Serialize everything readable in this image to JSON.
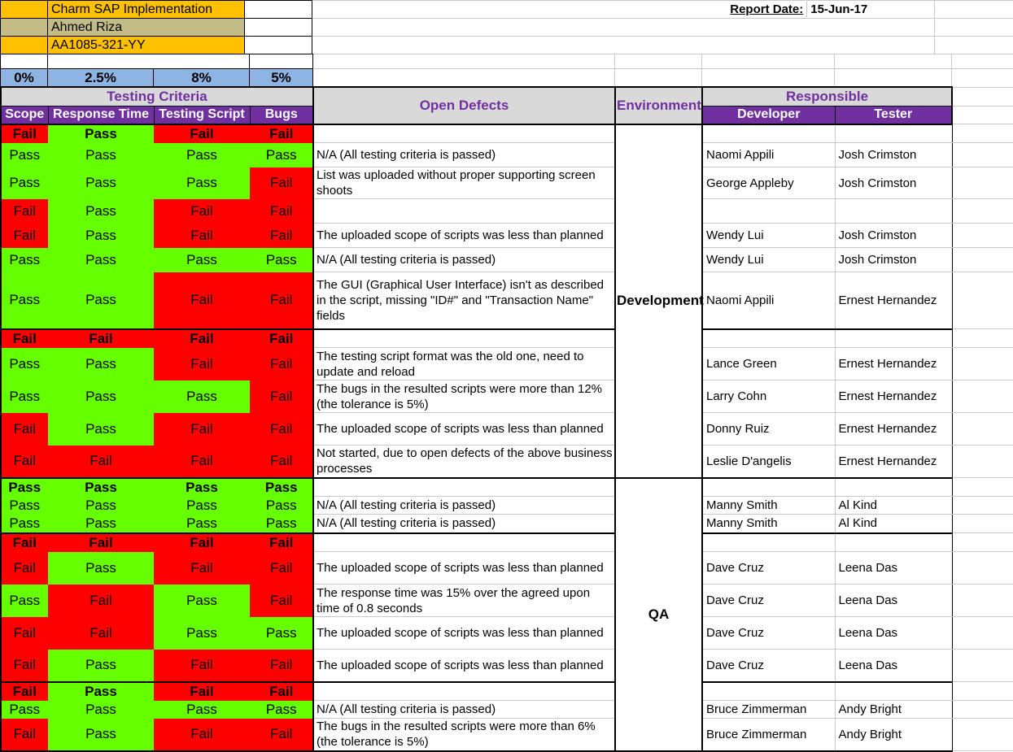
{
  "project": {
    "name": "Charm SAP Implementation",
    "manager": "Ahmed Riza",
    "code": "AA1085-321-YY"
  },
  "report": {
    "date_label": "Report Date:",
    "date_value": "15-Jun-17"
  },
  "tolerances": {
    "scope": "0%",
    "response_time": "2.5%",
    "testing_script": "8%",
    "bugs": "5%"
  },
  "headers": {
    "testing_criteria": "Testing Criteria",
    "scope": "Scope",
    "response_time": "Response Time",
    "testing_script": "Testing Script",
    "bugs": "Bugs",
    "open_defects": "Open Defects",
    "environment": "Environment",
    "responsible": "Responsible",
    "developer": "Developer",
    "tester": "Tester"
  },
  "environments": {
    "development": "Development",
    "qa": "QA"
  },
  "status_values": {
    "pass": "Pass",
    "fail": "Fail"
  },
  "colors": {
    "pass": "#66FF00",
    "fail": "#FF0000",
    "header_purple": "#7030A0",
    "header_grey": "#D9D9D9",
    "tolerance_blue": "#8EB4E3",
    "title_gold": "#FFC000",
    "title_tan": "#C4BC86"
  },
  "rows": [
    {
      "scope": "Fail",
      "response": "Pass",
      "script": "Fail",
      "bugs": "Fail",
      "summary": true,
      "defect": "",
      "developer": "",
      "tester": ""
    },
    {
      "scope": "Pass",
      "response": "Pass",
      "script": "Pass",
      "bugs": "Pass",
      "summary": false,
      "defect": "N/A (All testing criteria is passed)",
      "developer": "Naomi Appili",
      "tester": "Josh Crimston"
    },
    {
      "scope": "Pass",
      "response": "Pass",
      "script": "Pass",
      "bugs": "Fail",
      "summary": false,
      "defect": "List was uploaded without proper supporting screen shoots",
      "developer": "George Appleby",
      "tester": "Josh Crimston"
    },
    {
      "scope": "Fail",
      "response": "Pass",
      "script": "Fail",
      "bugs": "Fail",
      "summary": false,
      "defect": "",
      "developer": "",
      "tester": ""
    },
    {
      "scope": "Fail",
      "response": "Pass",
      "script": "Fail",
      "bugs": "Fail",
      "summary": false,
      "defect": "The uploaded scope of scripts was less than planned",
      "developer": "Wendy Lui",
      "tester": "Josh Crimston"
    },
    {
      "scope": "Pass",
      "response": "Pass",
      "script": "Pass",
      "bugs": "Pass",
      "summary": false,
      "defect": "N/A (All testing criteria is passed)",
      "developer": "Wendy Lui",
      "tester": "Josh Crimston"
    },
    {
      "scope": "Pass",
      "response": "Pass",
      "script": "Fail",
      "bugs": "Fail",
      "summary": false,
      "defect": "The GUI (Graphical User Interface) isn't as described in the script, missing \"ID#\" and \"Transaction Name\" fields",
      "developer": "Naomi Appili",
      "tester": "Ernest Hernandez"
    },
    {
      "scope": "Fail",
      "response": "Fail",
      "script": "Fail",
      "bugs": "Fail",
      "summary": true,
      "defect": "",
      "developer": "",
      "tester": ""
    },
    {
      "scope": "Pass",
      "response": "Pass",
      "script": "Fail",
      "bugs": "Fail",
      "summary": false,
      "defect": "The testing script format was the old one, need to update and reload",
      "developer": "Lance Green",
      "tester": "Ernest Hernandez"
    },
    {
      "scope": "Pass",
      "response": "Pass",
      "script": "Pass",
      "bugs": "Fail",
      "summary": false,
      "defect": "The bugs in the resulted scripts were more than 12% (the tolerance is 5%)",
      "developer": "Larry Cohn",
      "tester": "Ernest Hernandez"
    },
    {
      "scope": "Fail",
      "response": "Pass",
      "script": "Fail",
      "bugs": "Fail",
      "summary": false,
      "defect": "The uploaded scope of scripts was less than planned",
      "developer": "Donny Ruiz",
      "tester": "Ernest Hernandez"
    },
    {
      "scope": "Fail",
      "response": "Fail",
      "script": "Fail",
      "bugs": "Fail",
      "summary": false,
      "defect": "Not started, due to open defects of the above business processes",
      "developer": "Leslie D'angelis",
      "tester": "Ernest Hernandez"
    },
    {
      "scope": "Pass",
      "response": "Pass",
      "script": "Pass",
      "bugs": "Pass",
      "summary": true,
      "defect": "",
      "developer": "",
      "tester": ""
    },
    {
      "scope": "Pass",
      "response": "Pass",
      "script": "Pass",
      "bugs": "Pass",
      "summary": false,
      "defect": "N/A (All testing criteria is passed)",
      "developer": "Manny Smith",
      "tester": "Al Kind"
    },
    {
      "scope": "Pass",
      "response": "Pass",
      "script": "Pass",
      "bugs": "Pass",
      "summary": false,
      "defect": "N/A (All testing criteria is passed)",
      "developer": "Manny Smith",
      "tester": "Al Kind"
    },
    {
      "scope": "Fail",
      "response": "Fail",
      "script": "Fail",
      "bugs": "Fail",
      "summary": true,
      "defect": "",
      "developer": "",
      "tester": ""
    },
    {
      "scope": "Fail",
      "response": "Pass",
      "script": "Fail",
      "bugs": "Fail",
      "summary": false,
      "defect": "The uploaded scope of scripts was less than planned",
      "developer": "Dave Cruz",
      "tester": "Leena Das"
    },
    {
      "scope": "Pass",
      "response": "Fail",
      "script": "Pass",
      "bugs": "Fail",
      "summary": false,
      "defect": "The response time was 15% over the agreed upon time of 0.8 seconds",
      "developer": "Dave Cruz",
      "tester": "Leena Das"
    },
    {
      "scope": "Fail",
      "response": "Fail",
      "script": "Pass",
      "bugs": "Pass",
      "summary": false,
      "defect": "The uploaded scope of scripts was less than planned",
      "developer": "Dave Cruz",
      "tester": "Leena Das"
    },
    {
      "scope": "Fail",
      "response": "Pass",
      "script": "Fail",
      "bugs": "Fail",
      "summary": false,
      "defect": "The uploaded scope of scripts was less than planned",
      "developer": "Dave Cruz",
      "tester": "Leena Das"
    },
    {
      "scope": "Fail",
      "response": "Pass",
      "script": "Fail",
      "bugs": "Fail",
      "summary": true,
      "defect": "",
      "developer": "",
      "tester": ""
    },
    {
      "scope": "Pass",
      "response": "Pass",
      "script": "Pass",
      "bugs": "Pass",
      "summary": false,
      "defect": "N/A (All testing criteria is passed)",
      "developer": "Bruce Zimmerman",
      "tester": "Andy Bright"
    },
    {
      "scope": "Fail",
      "response": "Pass",
      "script": "Fail",
      "bugs": "Fail",
      "summary": false,
      "defect": "The bugs in the resulted scripts were more than 6% (the tolerance is 5%)",
      "developer": "Bruce Zimmerman",
      "tester": "Andy Bright"
    }
  ]
}
